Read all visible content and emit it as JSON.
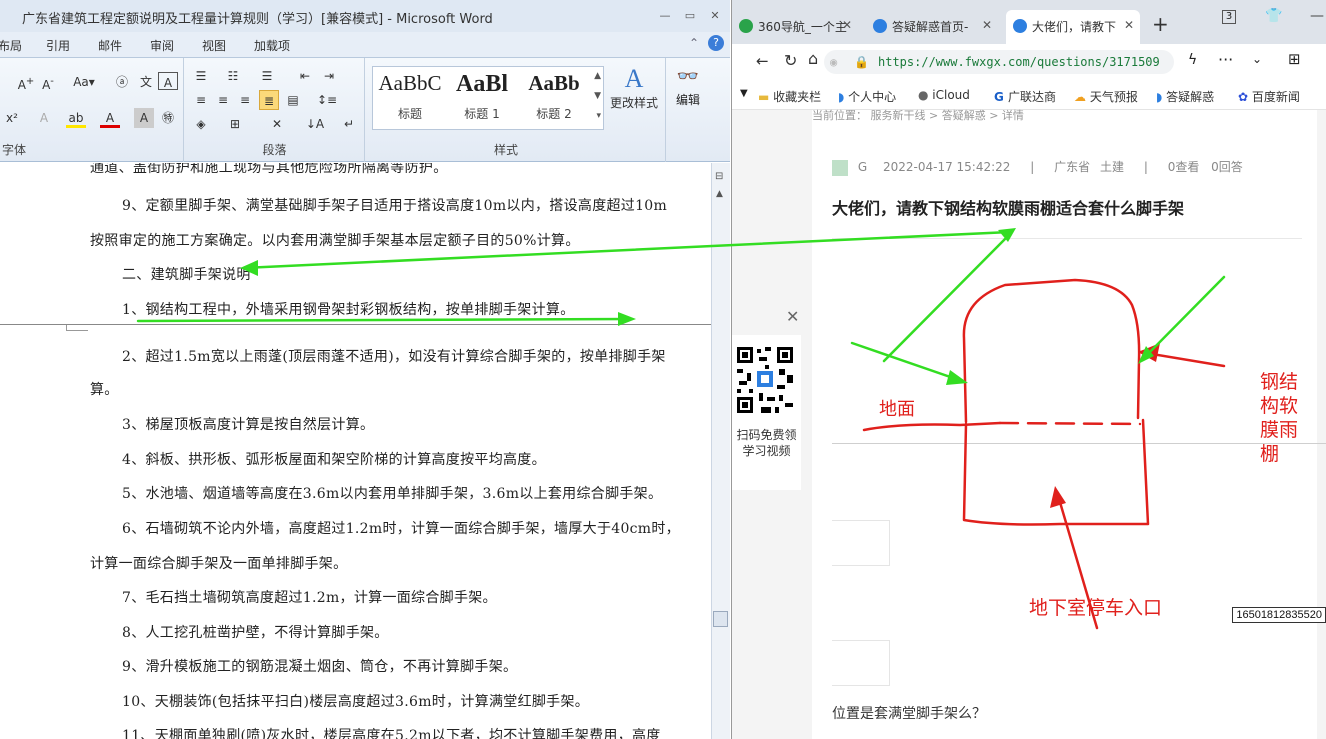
{
  "word": {
    "title": "广东省建筑工程定额说明及工程量计算规则（学习）[兼容模式] - Microsoft Word",
    "tabs": [
      "布局",
      "引用",
      "邮件",
      "审阅",
      "视图",
      "加载项"
    ],
    "ribbon": {
      "groups": {
        "font": "字体",
        "paragraph": "段落",
        "styles": "样式"
      },
      "styles": [
        {
          "preview": "AaBbC",
          "label": "标题"
        },
        {
          "preview": "AaBl",
          "label": "标题 1"
        },
        {
          "preview": "AaBb",
          "label": "标题 2"
        }
      ],
      "change_styles": "更改样式",
      "edit": "编辑"
    },
    "paragraphs": [
      "通道、盖街防护和施工现场与其他危险场所隔离等防护。",
      "9、定额里脚手架、满堂基础脚手架子目适用于搭设高度10m以内，搭设高度超过10m",
      "按照审定的施工方案确定。以内套用满堂脚手架基本层定额子目的50%计算。",
      "二、建筑脚手架说明",
      "1、钢结构工程中，外墙采用钢骨架封彩钢板结构，按单排脚手架计算。",
      "2、超过1.5m宽以上雨蓬(顶层雨蓬不适用)，如没有计算综合脚手架的，按单排脚手架",
      "算。",
      "3、梯屋顶板高度计算是按自然层计算。",
      "4、斜板、拱形板、弧形板屋面和架空阶梯的计算高度按平均高度。",
      "5、水池墙、烟道墙等高度在3.6m以内套用单排脚手架，3.6m以上套用综合脚手架。",
      "6、石墙砌筑不论内外墙，高度超过1.2m时，计算一面综合脚手架，墙厚大于40cm时，",
      "计算一面综合脚手架及一面单排脚手架。",
      "7、毛石挡土墙砌筑高度超过1.2m，计算一面综合脚手架。",
      "8、人工挖孔桩凿护壁，不得计算脚手架。",
      "9、滑升模板施工的钢筋混凝土烟囱、筒仓，不再计算脚手架。",
      "10、天棚装饰(包括抹平扫白)楼层高度超过3.6m时，计算满堂红脚手架。",
      "11、天棚面单独刷(喷)灰水时，楼层高度在5.2m以下者，均不计算脚手架费用，高度"
    ]
  },
  "browser": {
    "tabs": [
      {
        "label": "360导航_一个主",
        "active": false
      },
      {
        "label": "答疑解惑首页-",
        "active": false
      },
      {
        "label": "大佬们，请教下",
        "active": true
      }
    ],
    "tab_count": "3",
    "url": "https://www.fwxgx.com/questions/3171509",
    "bookmarks": [
      "收藏夹栏",
      "个人中心",
      "iCloud",
      "广联达商",
      "天气预报",
      "答疑解惑",
      "百度新闻"
    ],
    "breadcrumb": "当前位置： 服务新干线 > 答疑解惑 > 详情",
    "question": {
      "author": "G",
      "date": "2022-04-17 15:42:22",
      "region": "广东省",
      "category": "土建",
      "views": "0查看",
      "answers": "0回答",
      "title": "大佬们，请教下钢结构软膜雨棚适合套什么脚手架",
      "followup": "位置是套满堂脚手架么？"
    },
    "qr_text": "扫码免费领学习视频",
    "sketch_labels": {
      "ground": "地面",
      "canopy": "钢结构软膜雨棚",
      "entrance": "地下室停车入口"
    },
    "id_tag": "16501812835520"
  },
  "colors": {
    "annotation_green": "#33dd22",
    "annotation_red": "#e0201c",
    "link_green": "#1a7a3a"
  }
}
